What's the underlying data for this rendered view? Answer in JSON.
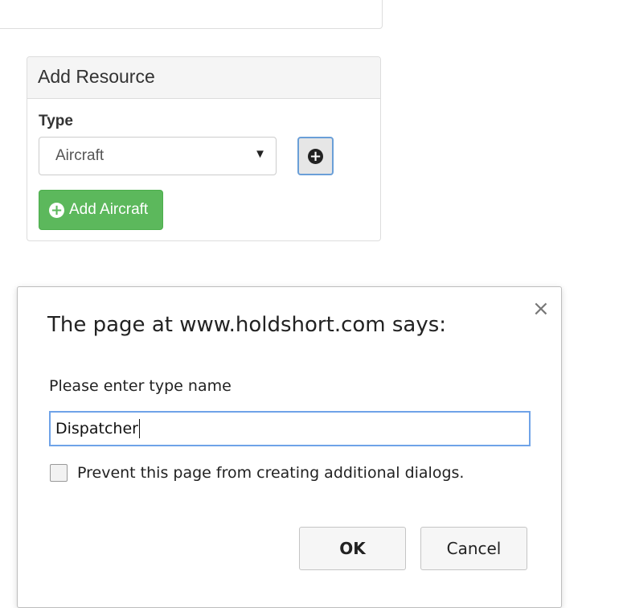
{
  "add_resource_panel": {
    "title": "Add Resource",
    "type_label": "Type",
    "type_select_value": "Aircraft",
    "add_button_label": "Add Aircraft"
  },
  "dialog": {
    "title": "The page at www.holdshort.com says:",
    "message": "Please enter type name",
    "input_value": "Dispatcher",
    "prevent_label": "Prevent this page from creating additional dialogs.",
    "ok_label": "OK",
    "cancel_label": "Cancel",
    "close_glyph": "×"
  },
  "icons": {
    "select_caret": "▼",
    "plus_glyph": "+"
  },
  "colors": {
    "success_green": "#5cb85c",
    "focus_blue": "#6fa3e8"
  }
}
